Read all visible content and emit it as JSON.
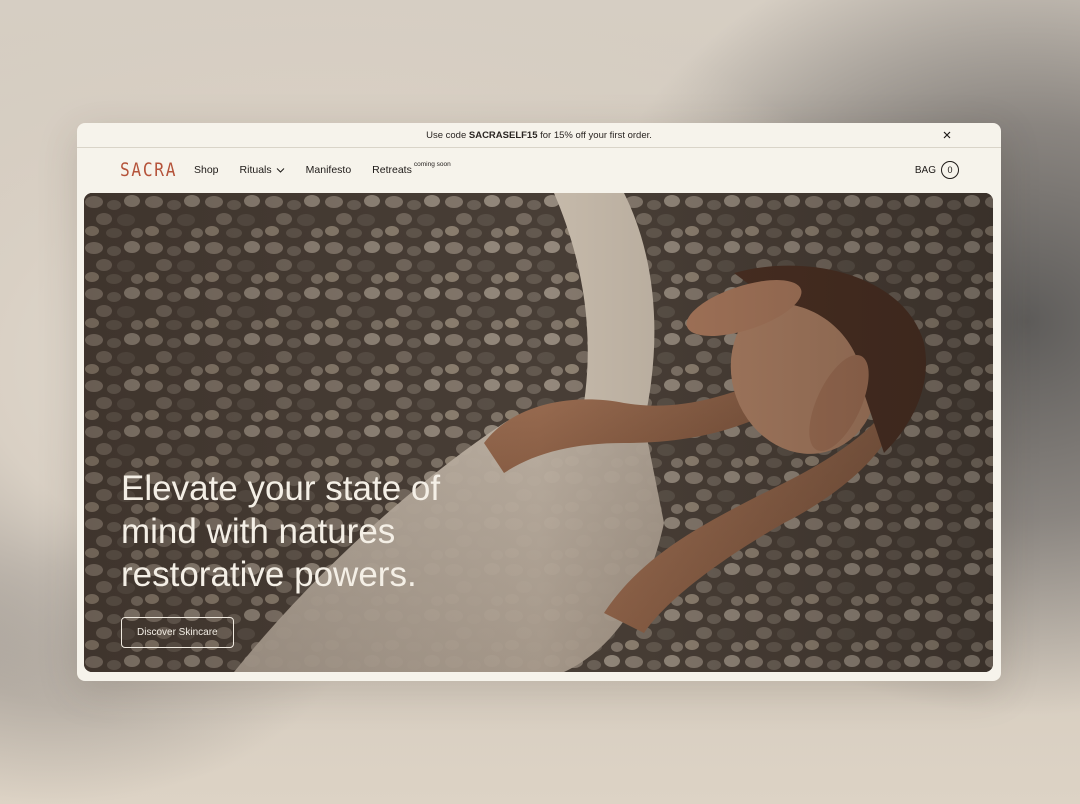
{
  "announcement": {
    "prefix": "Use code ",
    "code": "SACRASELF15",
    "suffix": " for 15% off your first order."
  },
  "nav": {
    "logo": "SACRA",
    "items": [
      {
        "label": "Shop"
      },
      {
        "label": "Rituals",
        "dropdown": true
      },
      {
        "label": "Manifesto"
      },
      {
        "label": "Retreats",
        "badge": "coming soon"
      }
    ],
    "bag_label": "BAG",
    "bag_count": "0"
  },
  "hero": {
    "headline_lines": [
      "Elevate your state of",
      "mind with natures",
      "restorative powers."
    ],
    "cta_label": "Discover Skincare"
  },
  "colors": {
    "brand": "#b5533a",
    "window_bg": "#f6f3eb",
    "hero_text": "#f4efe6"
  },
  "icons": [
    "close-icon",
    "chevron-down-icon"
  ]
}
